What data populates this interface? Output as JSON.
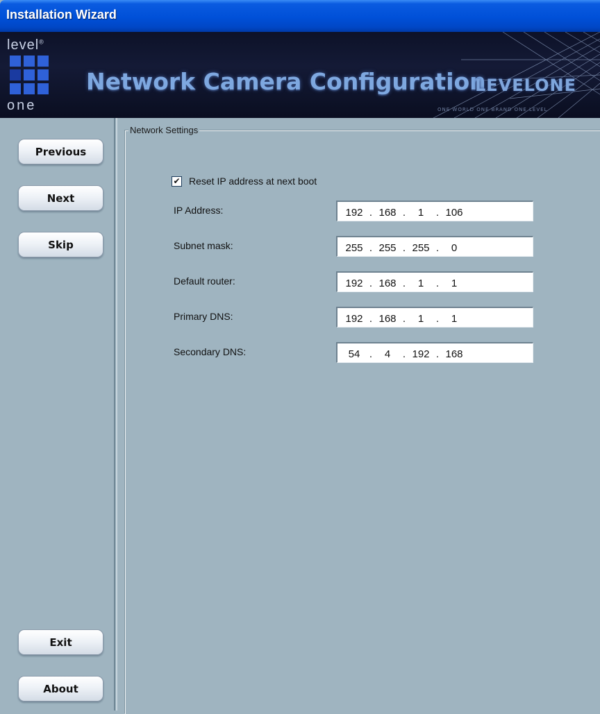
{
  "window": {
    "title": "Installation Wizard"
  },
  "banner": {
    "logo_top": "level",
    "logo_mark": "®",
    "logo_bottom": "one",
    "heading": "Network Camera Configuration",
    "brand": "LEVELONE",
    "tagline": "ONE WORLD ONE BRAND ONE LEVEL"
  },
  "sidebar": {
    "buttons": [
      {
        "label": "Previous"
      },
      {
        "label": "Next"
      },
      {
        "label": "Skip"
      },
      {
        "label": "Exit"
      },
      {
        "label": "About"
      }
    ]
  },
  "network_settings": {
    "legend": "Network Settings",
    "reset_checkbox": {
      "label": "Reset IP address at next boot",
      "checked": true,
      "mark": "✔"
    },
    "fields": [
      {
        "label": "IP Address:",
        "octets": [
          "192",
          "168",
          "1",
          "106"
        ]
      },
      {
        "label": "Subnet mask:",
        "octets": [
          "255",
          "255",
          "255",
          "0"
        ]
      },
      {
        "label": "Default router:",
        "octets": [
          "192",
          "168",
          "1",
          "1"
        ]
      },
      {
        "label": "Primary DNS:",
        "octets": [
          "192",
          "168",
          "1",
          "1"
        ]
      },
      {
        "label": "Secondary DNS:",
        "octets": [
          "54",
          "4",
          "192",
          "168"
        ]
      }
    ],
    "separator": "."
  }
}
